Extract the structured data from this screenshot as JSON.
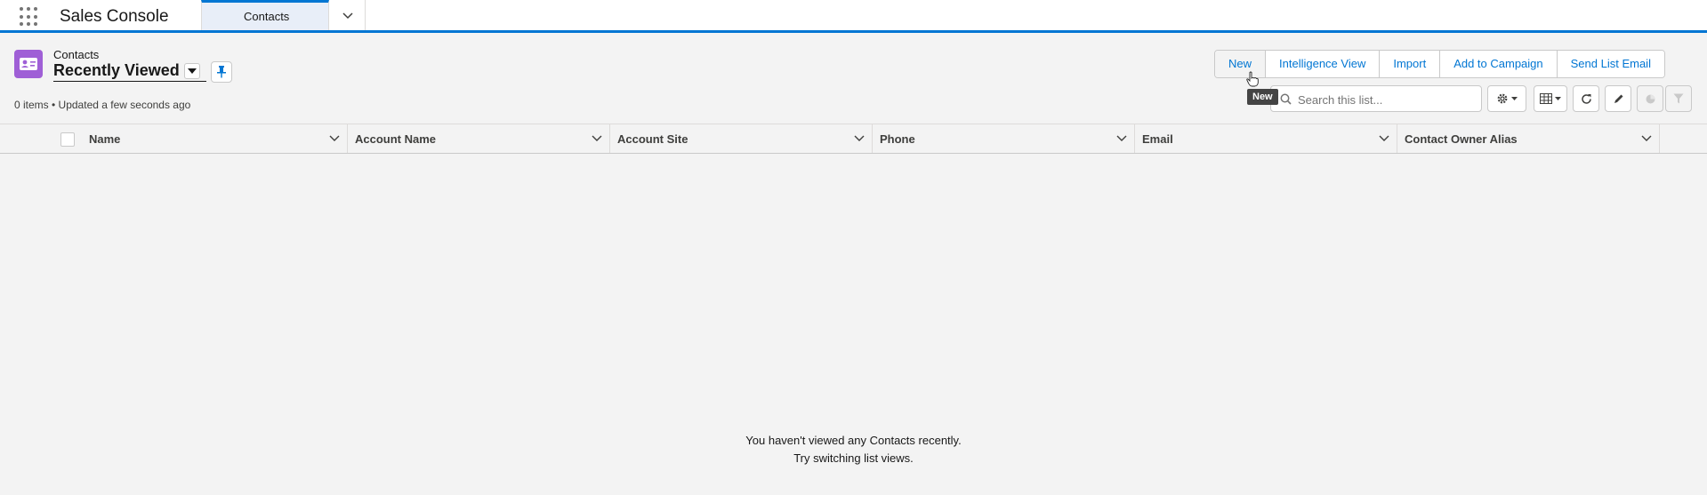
{
  "app": {
    "name": "Sales Console"
  },
  "tabs": [
    {
      "label": "Contacts"
    }
  ],
  "header": {
    "object_label": "Contacts",
    "view_name": "Recently Viewed",
    "status": "0 items • Updated a few seconds ago"
  },
  "actions": {
    "new": "New",
    "intelligence_view": "Intelligence View",
    "import": "Import",
    "add_to_campaign": "Add to Campaign",
    "send_list_email": "Send List Email"
  },
  "tooltip": "New",
  "search": {
    "placeholder": "Search this list..."
  },
  "columns": [
    "Name",
    "Account Name",
    "Account Site",
    "Phone",
    "Email",
    "Contact Owner Alias"
  ],
  "empty": {
    "line1": "You haven't viewed any Contacts recently.",
    "line2": "Try switching list views."
  },
  "colors": {
    "brand": "#0176d3",
    "object_icon": "#9f5fd6"
  },
  "icons": [
    "app-launcher-icon",
    "chevron-down-icon",
    "contact-icon",
    "pin-icon",
    "search-icon",
    "gear-icon",
    "table-icon",
    "refresh-icon",
    "edit-icon",
    "chart-icon",
    "filter-icon"
  ]
}
